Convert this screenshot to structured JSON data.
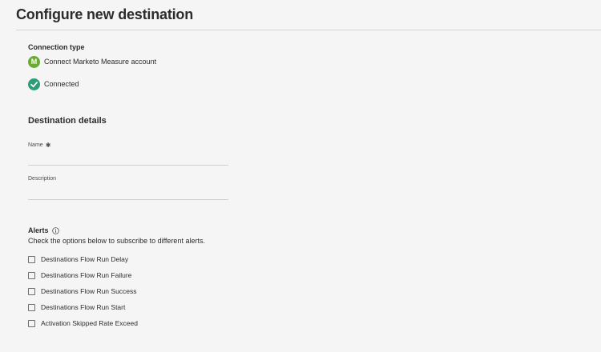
{
  "page": {
    "title": "Configure new destination"
  },
  "connection": {
    "section_label": "Connection type",
    "account_initial": "M",
    "account_label": "Connect Marketo Measure account",
    "status_label": "Connected",
    "avatar_color": "#6aab33",
    "status_color": "#2d9d78"
  },
  "details": {
    "title": "Destination details",
    "name_label": "Name",
    "name_value": "",
    "description_label": "Description",
    "description_value": ""
  },
  "alerts": {
    "title": "Alerts",
    "description": "Check the options below to subscribe to different alerts.",
    "options": [
      {
        "label": "Destinations Flow Run Delay",
        "checked": false
      },
      {
        "label": "Destinations Flow Run Failure",
        "checked": false
      },
      {
        "label": "Destinations Flow Run Success",
        "checked": false
      },
      {
        "label": "Destinations Flow Run Start",
        "checked": false
      },
      {
        "label": "Activation Skipped Rate Exceed",
        "checked": false
      }
    ]
  },
  "icons": {
    "account": "account-avatar-icon",
    "connected": "checkmark-circle-icon",
    "required": "asterisk-icon",
    "info": "info-icon",
    "checkbox": "checkbox-icon"
  }
}
